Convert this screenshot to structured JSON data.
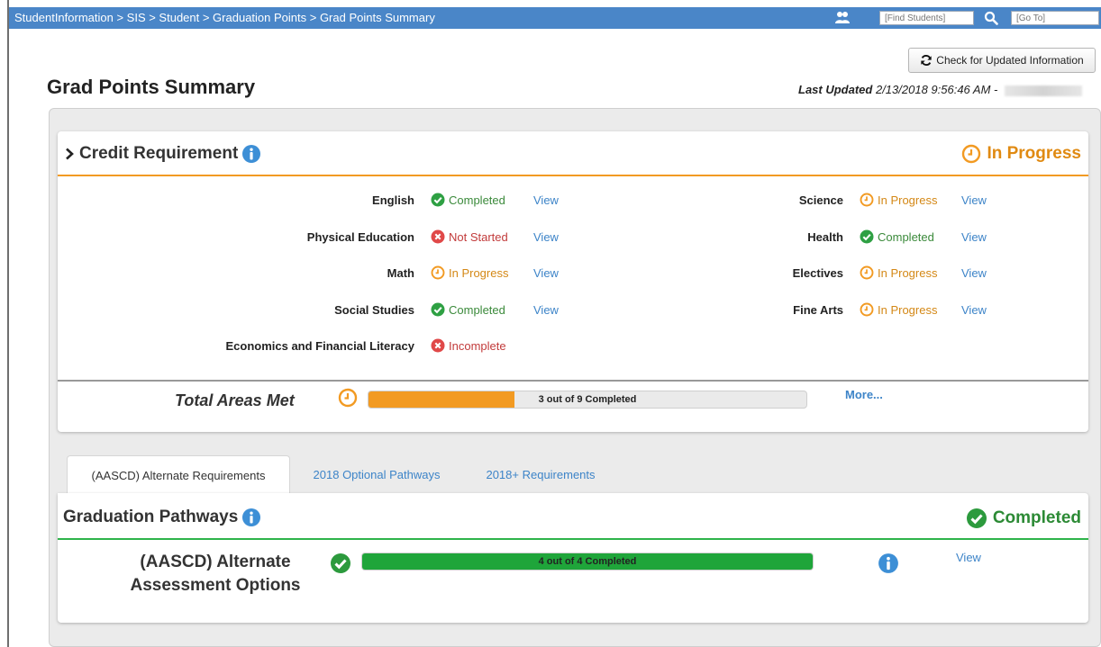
{
  "topbar": {
    "breadcrumb": "StudentInformation > SIS > Student > Graduation Points > Grad Points Summary",
    "find_placeholder": "[Find Students]",
    "goto_placeholder": "[Go To]"
  },
  "header": {
    "title": "Grad Points Summary",
    "refresh_label": "Check for Updated Information",
    "last_updated_label": "Last Updated",
    "last_updated_value": "2/13/2018 9:56:46 AM -"
  },
  "credit": {
    "title": "Credit Requirement",
    "status": "In Progress",
    "left_rows": [
      {
        "label": "English",
        "status": "Completed",
        "view": "View"
      },
      {
        "label": "Physical Education",
        "status": "Not Started",
        "view": "View"
      },
      {
        "label": "Math",
        "status": "In Progress",
        "view": "View"
      },
      {
        "label": "Social Studies",
        "status": "Completed",
        "view": "View"
      },
      {
        "label": "Economics and Financial Literacy",
        "status": "Incomplete",
        "view": ""
      }
    ],
    "right_rows": [
      {
        "label": "Science",
        "status": "In Progress",
        "view": "View"
      },
      {
        "label": "Health",
        "status": "Completed",
        "view": "View"
      },
      {
        "label": "Electives",
        "status": "In Progress",
        "view": "View"
      },
      {
        "label": "Fine Arts",
        "status": "In Progress",
        "view": "View"
      }
    ],
    "total_label": "Total Areas Met",
    "progress_text": "3 out of 9 Completed",
    "progress_fraction": 0.333,
    "more_label": "More..."
  },
  "tabs": [
    {
      "label": "(AASCD) Alternate Requirements",
      "active": true
    },
    {
      "label": "2018 Optional Pathways",
      "active": false
    },
    {
      "label": "2018+ Requirements",
      "active": false
    }
  ],
  "pathways": {
    "title": "Graduation Pathways",
    "status": "Completed",
    "item_label": "(AASCD) Alternate Assessment Options",
    "progress_text": "4 out of 4 Completed",
    "progress_fraction": 1.0,
    "view_label": "View"
  },
  "colors": {
    "topbar": "#4a86c8",
    "in_progress": "#f29a22",
    "completed": "#2fb34a",
    "not_started": "#e04848",
    "link": "#3d84c8"
  }
}
